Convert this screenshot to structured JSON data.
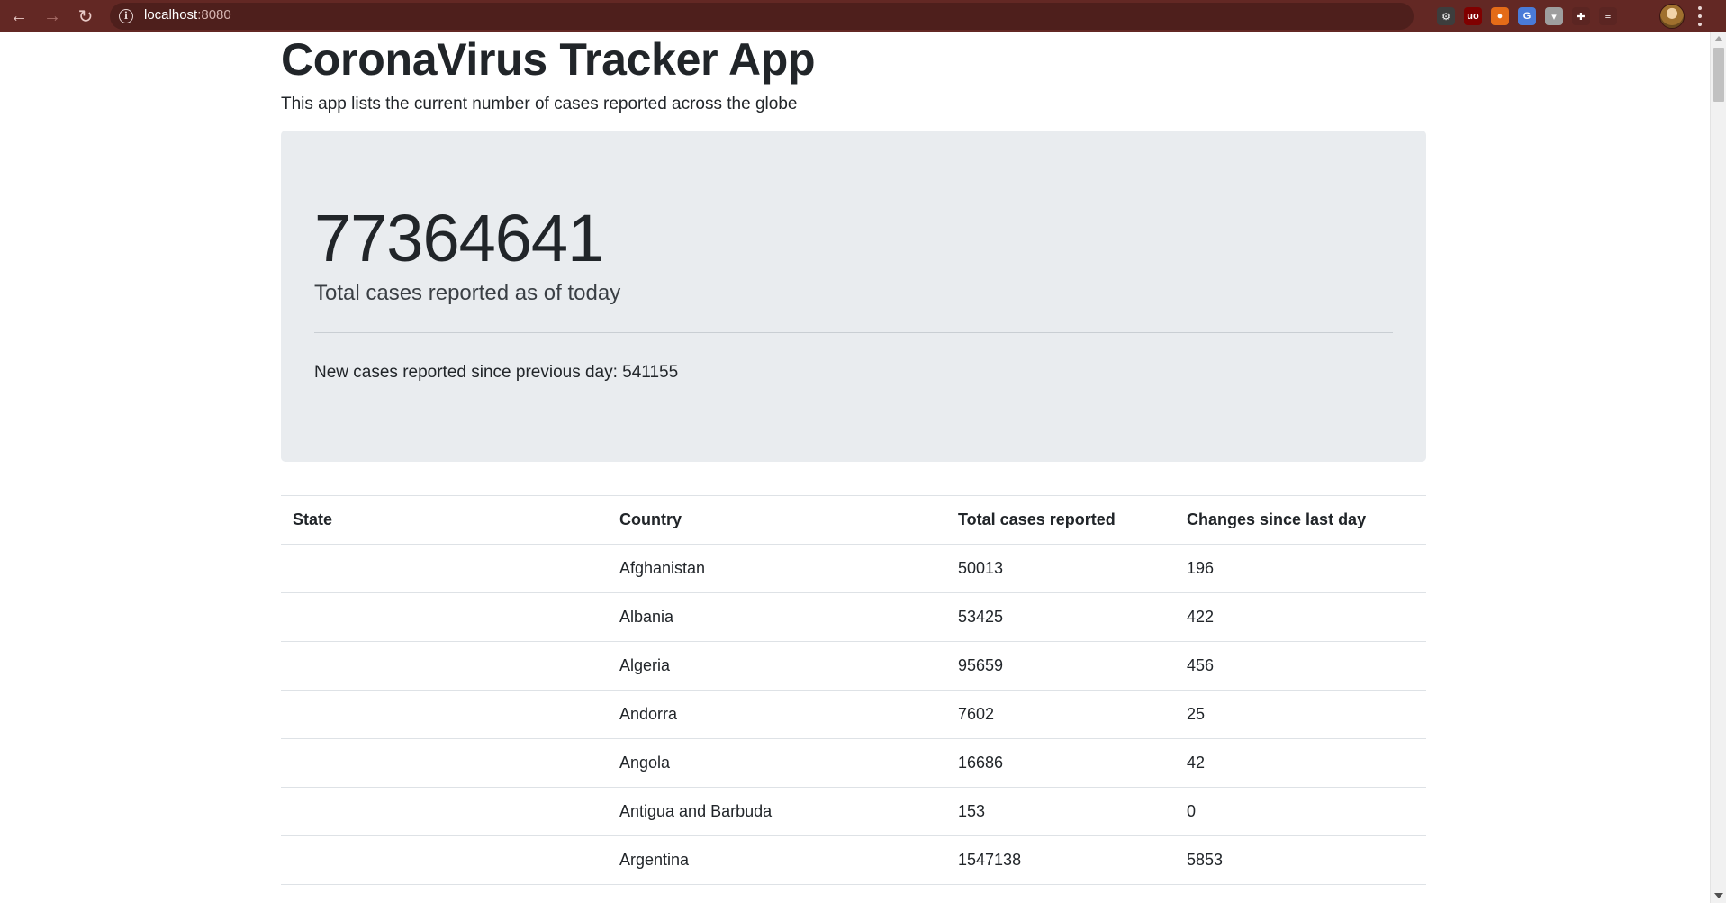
{
  "browser": {
    "url_host": "localhost",
    "url_port": ":8080",
    "colors": {
      "toolbar": "#632824",
      "omnibox": "#4e1f1c"
    },
    "extensions": [
      {
        "name": "gear-extension-icon",
        "glyph": "⚙",
        "color": "#3d3d3d"
      },
      {
        "name": "ublock-extension-icon",
        "glyph": "uo",
        "color": "#800000"
      },
      {
        "name": "fox-extension-icon",
        "glyph": "●",
        "color": "#e46b18"
      },
      {
        "name": "translate-extension-icon",
        "glyph": "G",
        "color": "#4a7bd8"
      },
      {
        "name": "bucket-extension-icon",
        "glyph": "▾",
        "color": "#9e9e9e"
      },
      {
        "name": "puzzle-extensions-icon",
        "glyph": "✚",
        "color": "#5b2522"
      },
      {
        "name": "media-queue-icon",
        "glyph": "≡",
        "color": "#5b2522"
      }
    ]
  },
  "page": {
    "title": "CoronaVirus Tracker App",
    "subtitle": "This app lists the current number of cases reported across the globe"
  },
  "summary": {
    "total_cases": "77364641",
    "total_label": "Total cases reported as of today",
    "new_cases_text": "New cases reported since previous day: 541155"
  },
  "table": {
    "headers": [
      "State",
      "Country",
      "Total cases reported",
      "Changes since last day"
    ],
    "rows": [
      {
        "state": "",
        "country": "Afghanistan",
        "total": "50013",
        "change": "196"
      },
      {
        "state": "",
        "country": "Albania",
        "total": "53425",
        "change": "422"
      },
      {
        "state": "",
        "country": "Algeria",
        "total": "95659",
        "change": "456"
      },
      {
        "state": "",
        "country": "Andorra",
        "total": "7602",
        "change": "25"
      },
      {
        "state": "",
        "country": "Angola",
        "total": "16686",
        "change": "42"
      },
      {
        "state": "",
        "country": "Antigua and Barbuda",
        "total": "153",
        "change": "0"
      },
      {
        "state": "",
        "country": "Argentina",
        "total": "1547138",
        "change": "5853"
      }
    ]
  }
}
